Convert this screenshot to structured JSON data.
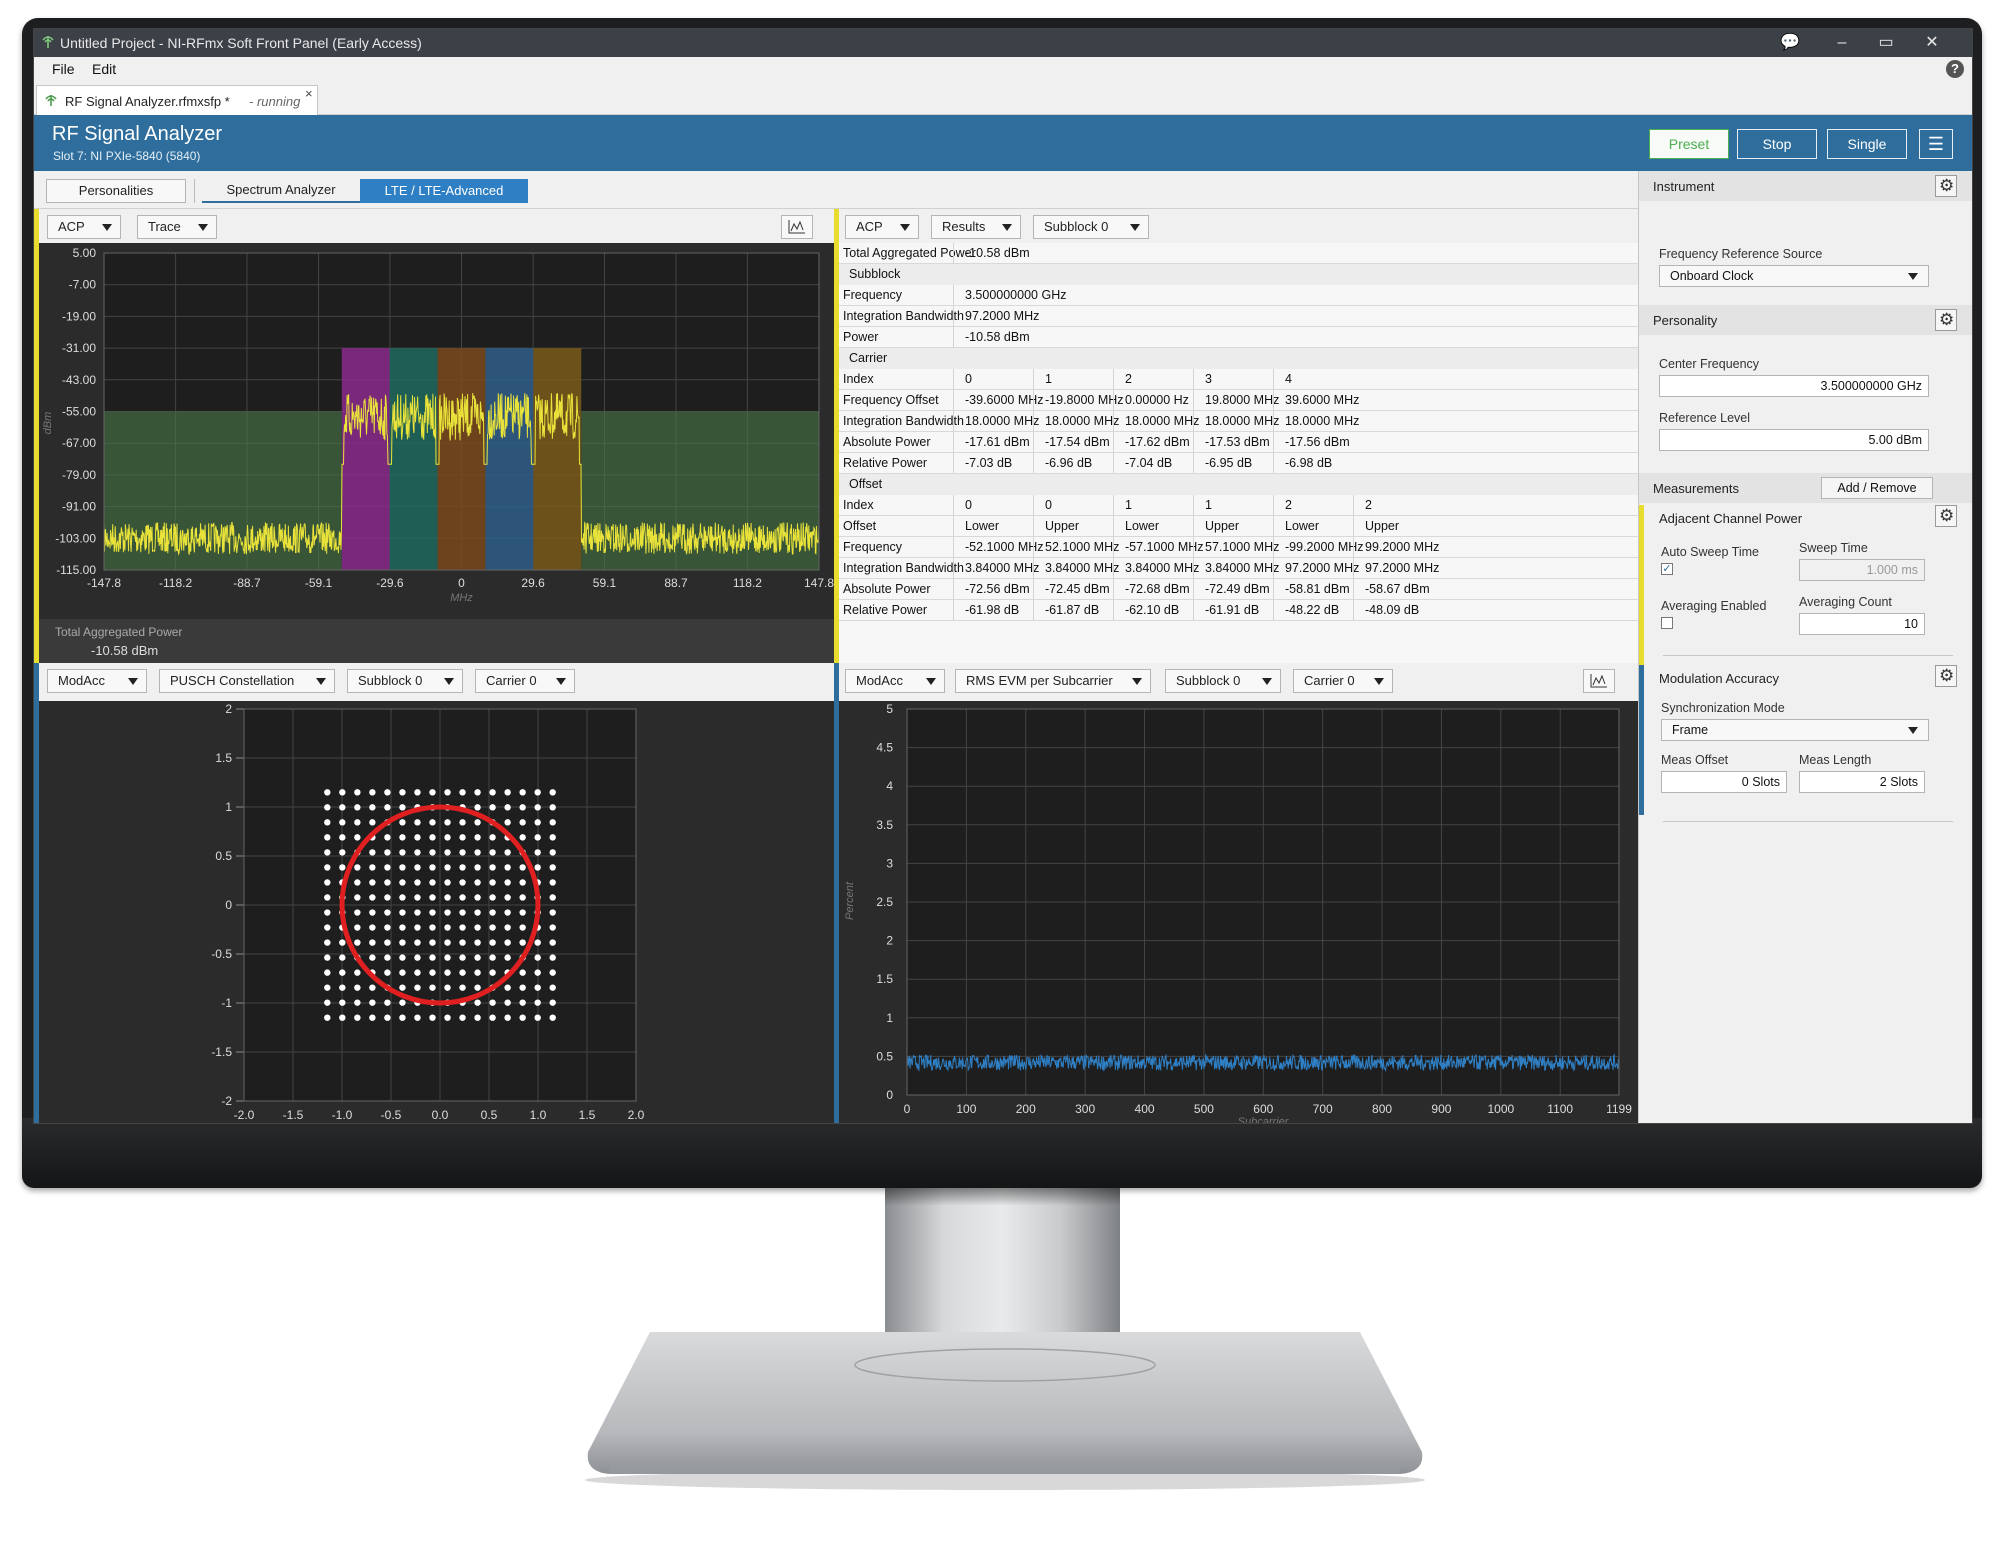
{
  "window": {
    "title": "Untitled Project - NI-RFmx Soft Front Panel (Early Access)",
    "minimize": "–",
    "maximize": "▭",
    "close": "✕",
    "feedback": "💬"
  },
  "menu": {
    "file": "File",
    "edit": "Edit",
    "help": "?"
  },
  "doc_tab": {
    "name": "RF Signal Analyzer.rfmxsfp *",
    "status": "- running",
    "close": "×"
  },
  "header": {
    "title": "RF Signal Analyzer",
    "subtitle": "Slot 7: NI PXIe-5840 (5840)",
    "preset": "Preset",
    "stop": "Stop",
    "single": "Single",
    "accent_color": "#2f6e9c"
  },
  "personalities": {
    "button": "Personalities",
    "tabs": [
      "Spectrum Analyzer",
      "LTE / LTE-Advanced"
    ],
    "active_tab": "LTE / LTE-Advanced"
  },
  "panel_acp_plot": {
    "measurement": "ACP",
    "view": "Trace",
    "footer_label": "Total Aggregated Power",
    "footer_value": "-10.58 dBm"
  },
  "panel_acp_results": {
    "measurement": "ACP",
    "view": "Results",
    "subblock": "Subblock 0",
    "total_label": "Total Aggregated Power",
    "total_value": "-10.58 dBm",
    "subblock_section": "Subblock",
    "subblock_rows": [
      {
        "key": "Frequency",
        "value": "3.500000000 GHz"
      },
      {
        "key": "Integration Bandwidth",
        "value": "97.2000 MHz"
      },
      {
        "key": "Power",
        "value": "-10.58 dBm"
      }
    ],
    "carrier_section": "Carrier",
    "carrier_rows": [
      {
        "key": "Index",
        "values": [
          "0",
          "1",
          "2",
          "3",
          "4"
        ]
      },
      {
        "key": "Frequency Offset",
        "values": [
          "-39.6000 MHz",
          "-19.8000 MHz",
          "0.00000 Hz",
          "19.8000 MHz",
          "39.6000 MHz"
        ]
      },
      {
        "key": "Integration Bandwidth",
        "values": [
          "18.0000 MHz",
          "18.0000 MHz",
          "18.0000 MHz",
          "18.0000 MHz",
          "18.0000 MHz"
        ]
      },
      {
        "key": "Absolute Power",
        "values": [
          "-17.61 dBm",
          "-17.54 dBm",
          "-17.62 dBm",
          "-17.53 dBm",
          "-17.56 dBm"
        ]
      },
      {
        "key": "Relative Power",
        "values": [
          "-7.03 dB",
          "-6.96 dB",
          "-7.04 dB",
          "-6.95 dB",
          "-6.98 dB"
        ]
      }
    ],
    "offset_section": "Offset",
    "offset_rows": [
      {
        "key": "Index",
        "values": [
          "0",
          "0",
          "1",
          "1",
          "2",
          "2"
        ]
      },
      {
        "key": "Offset",
        "values": [
          "Lower",
          "Upper",
          "Lower",
          "Upper",
          "Lower",
          "Upper"
        ]
      },
      {
        "key": "Frequency",
        "values": [
          "-52.1000 MHz",
          "52.1000 MHz",
          "-57.1000 MHz",
          "57.1000 MHz",
          "-99.2000 MHz",
          "99.2000 MHz"
        ]
      },
      {
        "key": "Integration Bandwidth",
        "values": [
          "3.84000 MHz",
          "3.84000 MHz",
          "3.84000 MHz",
          "3.84000 MHz",
          "97.2000 MHz",
          "97.2000 MHz"
        ]
      },
      {
        "key": "Absolute Power",
        "values": [
          "-72.56 dBm",
          "-72.45 dBm",
          "-72.68 dBm",
          "-72.49 dBm",
          "-58.81 dBm",
          "-58.67 dBm"
        ]
      },
      {
        "key": "Relative Power",
        "values": [
          "-61.98 dB",
          "-61.87 dB",
          "-62.10 dB",
          "-61.91 dB",
          "-48.22 dB",
          "-48.09 dB"
        ]
      }
    ]
  },
  "panel_constellation": {
    "measurement": "ModAcc",
    "view": "PUSCH Constellation",
    "subblock": "Subblock 0",
    "carrier": "Carrier 0"
  },
  "panel_evm": {
    "measurement": "ModAcc",
    "view": "RMS EVM per Subcarrier",
    "subblock": "Subblock 0",
    "carrier": "Carrier 0"
  },
  "sidebar": {
    "instrument": "Instrument",
    "freq_ref_label": "Frequency Reference Source",
    "freq_ref_value": "Onboard Clock",
    "personality": "Personality",
    "center_freq_label": "Center Frequency",
    "center_freq_value": "3.500000000 GHz",
    "ref_level_label": "Reference Level",
    "ref_level_value": "5.00 dBm",
    "measurements": "Measurements",
    "add_remove": "Add / Remove",
    "acp_title": "Adjacent Channel Power",
    "auto_sweep_label": "Auto Sweep Time",
    "auto_sweep_checked": true,
    "sweep_time_label": "Sweep Time",
    "sweep_time_value": "1.000 ms",
    "avg_enabled_label": "Averaging Enabled",
    "avg_enabled_checked": false,
    "avg_count_label": "Averaging Count",
    "avg_count_value": "10",
    "modacc_title": "Modulation Accuracy",
    "sync_mode_label": "Synchronization Mode",
    "sync_mode_value": "Frame",
    "meas_offset_label": "Meas Offset",
    "meas_offset_value": "0 Slots",
    "meas_length_label": "Meas Length",
    "meas_length_value": "2 Slots"
  },
  "chart_data": [
    {
      "type": "line",
      "name": "ACP spectrum trace",
      "xlabel": "MHz",
      "ylabel": "dBm",
      "xlim": [
        -147.8,
        147.8
      ],
      "ylim": [
        -115,
        5
      ],
      "x_ticks": [
        "-147.8",
        "-118.2",
        "-88.7",
        "-59.1",
        "-29.6",
        "0",
        "29.6",
        "59.1",
        "88.7",
        "118.2",
        "147.8"
      ],
      "y_ticks": [
        "5.00",
        "-7.00",
        "-19.00",
        "-31.00",
        "-43.00",
        "-55.00",
        "-67.00",
        "-79.00",
        "-91.00",
        "-103.00",
        "-115.00"
      ],
      "noise_floor_dbm": -103,
      "carrier_level_dbm": -48,
      "carrier_band_mhz": [
        -49.5,
        49.5
      ],
      "offset_band_level_dbm": -55,
      "offset_bands_mhz": [
        [
          -147.8,
          -49.5
        ],
        [
          49.5,
          147.8
        ]
      ],
      "carrier_colors": [
        "#8b2a8c",
        "#1f6a5e",
        "#7a4a1c",
        "#2f5f8a",
        "#7a5a1a"
      ],
      "trace_color": "#e8e23a"
    },
    {
      "type": "scatter",
      "name": "PUSCH Constellation",
      "xlim": [
        -2.0,
        2.0
      ],
      "ylim": [
        -2,
        2
      ],
      "x_ticks": [
        "-2.0",
        "-1.5",
        "-1.0",
        "-0.5",
        "0.0",
        "0.5",
        "1.0",
        "1.5",
        "2.0"
      ],
      "y_ticks": [
        "2",
        "1.5",
        "1",
        "0.5",
        "0",
        "-0.5",
        "-1",
        "-1.5",
        "-2"
      ],
      "grid_points": 16,
      "grid_extent": [
        -1.15,
        1.15
      ],
      "reference_circle_radius": 1.0,
      "circle_color": "#e02020",
      "point_color": "#ffffff"
    },
    {
      "type": "line",
      "name": "RMS EVM per Subcarrier",
      "xlabel": "Subcarrier",
      "ylabel": "Percent",
      "xlim": [
        0,
        1199
      ],
      "ylim": [
        0,
        5
      ],
      "x_ticks": [
        "0",
        "100",
        "200",
        "300",
        "400",
        "500",
        "600",
        "700",
        "800",
        "900",
        "1000",
        "1100",
        "1199"
      ],
      "y_ticks": [
        "5",
        "4.5",
        "4",
        "3.5",
        "3",
        "2.5",
        "2",
        "1.5",
        "1",
        "0.5",
        "0"
      ],
      "mean_value": 0.42,
      "trace_color": "#2f7fc4"
    }
  ]
}
